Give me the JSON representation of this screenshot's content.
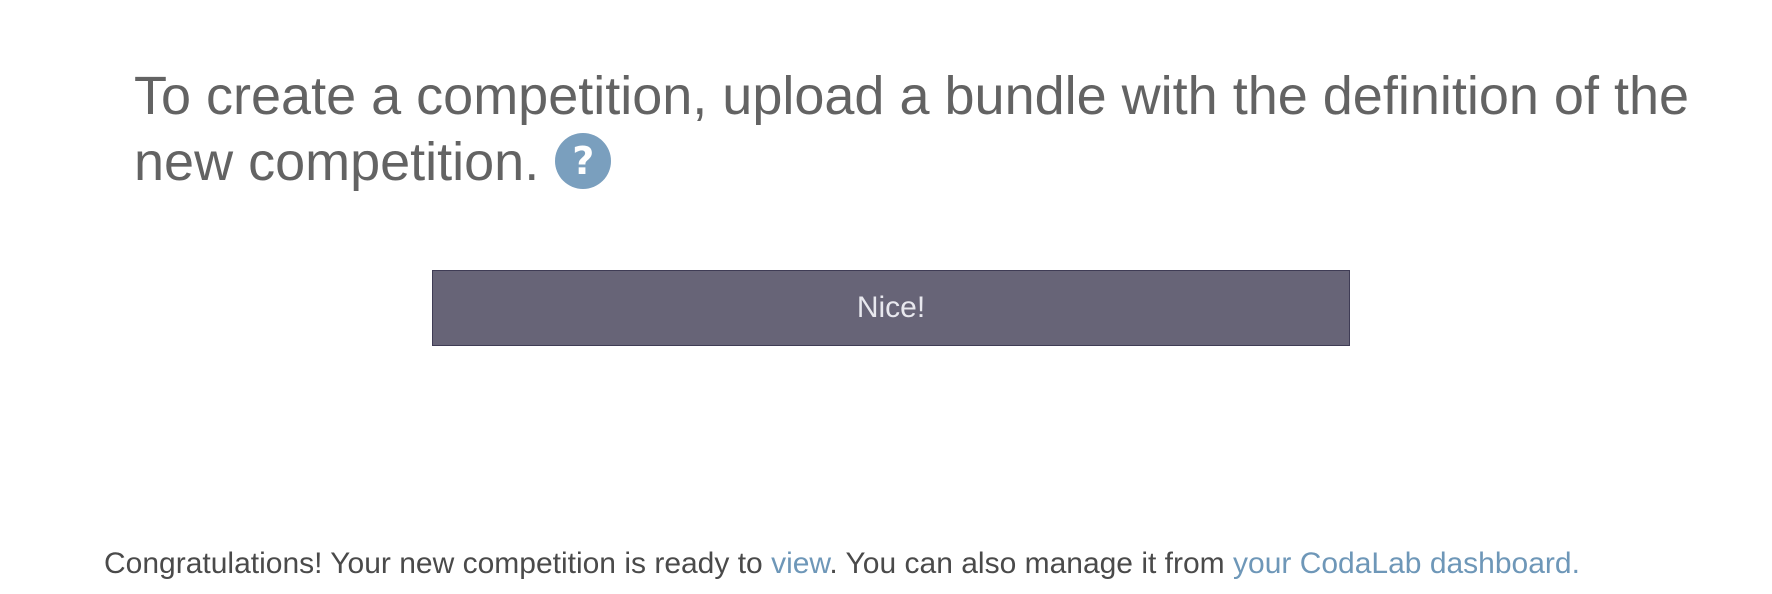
{
  "headline": {
    "text": "To create a competition, upload a bundle with the definition of the new competition.",
    "help_icon_glyph": "?",
    "help_icon_color": "#7a9fbe"
  },
  "upload_status": {
    "button_label": "Nice!",
    "button_color": "#676477"
  },
  "message": {
    "prefix": "Congratulations! Your new competition is ready to ",
    "view_link": "view",
    "middle": ". You can also manage it from ",
    "dashboard_link": "your CodaLab dashboard.",
    "link_color": "#6e97b8"
  }
}
